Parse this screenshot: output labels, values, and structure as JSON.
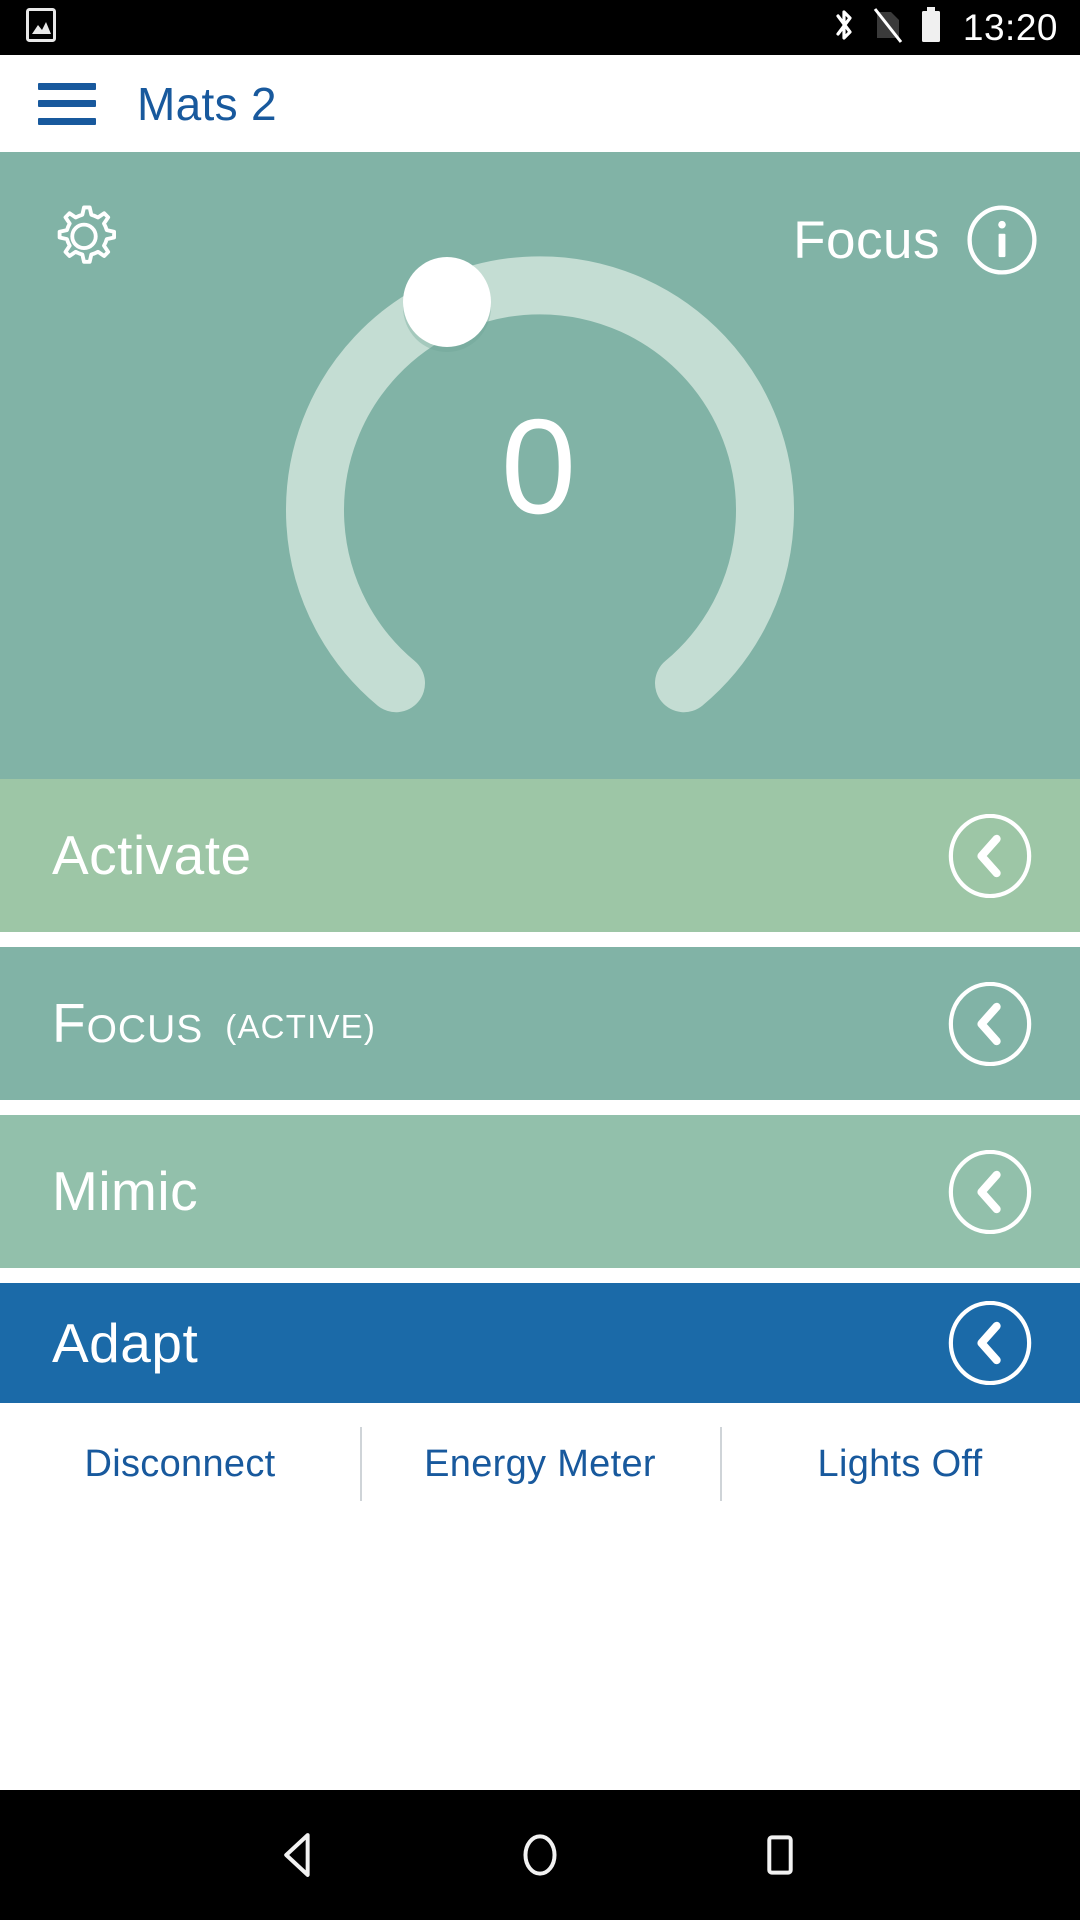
{
  "statusbar": {
    "icons": [
      "image-icon",
      "bluetooth-icon",
      "no-sim-icon",
      "battery-icon"
    ],
    "time": "13:20"
  },
  "appbar": {
    "menu_icon": "hamburger-menu-icon",
    "title": "Mats 2"
  },
  "hero": {
    "settings_icon": "gear-icon",
    "mode_label": "Focus",
    "info_icon": "info-icon",
    "dial_value": "0",
    "dial_min_icon": "bulb-dim-icon",
    "dial_max_icon": "bulb-bright-icon",
    "bg_color": "#81b3a6",
    "track_color": "#c4ddd3",
    "knob_color": "#ffffff"
  },
  "scenes": [
    {
      "label": "Activate",
      "state": "",
      "color": "#9dc6a6",
      "chevron": "chevron-left-icon"
    },
    {
      "label": "Focus",
      "state": "(ACTIVE)",
      "color": "#81b3a6",
      "chevron": "chevron-left-icon"
    },
    {
      "label": "Mimic",
      "state": "",
      "color": "#92c0ab",
      "chevron": "chevron-left-icon"
    },
    {
      "label": "Adapt",
      "state": "",
      "color": "#1b6aa8",
      "chevron": "chevron-left-icon"
    }
  ],
  "actions": [
    {
      "label": "Disconnect"
    },
    {
      "label": "Energy Meter"
    },
    {
      "label": "Lights Off"
    }
  ],
  "navbar": {
    "back": "back-triangle-icon",
    "home": "home-circle-icon",
    "recents": "recents-square-icon"
  },
  "colors": {
    "accent_blue": "#18599d",
    "white": "#ffffff",
    "black": "#000000"
  }
}
